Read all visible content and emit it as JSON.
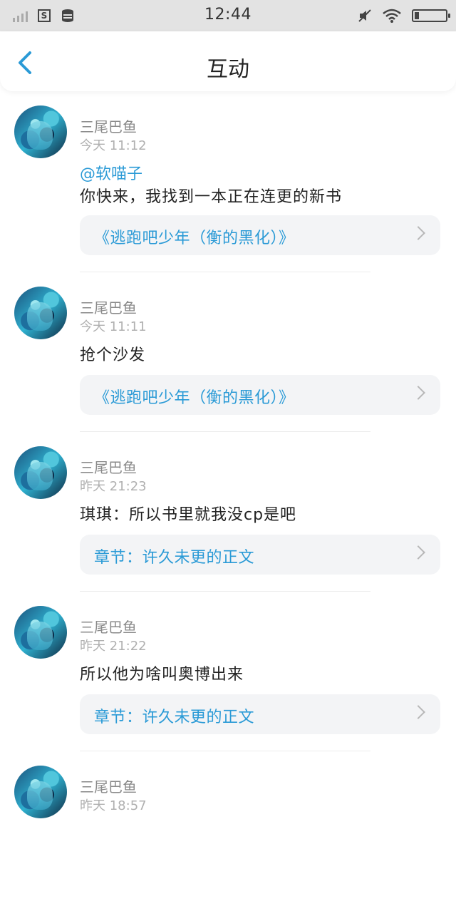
{
  "status_bar": {
    "time": "12:44"
  },
  "header": {
    "title": "互动"
  },
  "feed": [
    {
      "username": "三尾巴鱼",
      "time": "今天 11:12",
      "mention": "@软喵子",
      "text": "你快来，我找到一本正在连更的新书",
      "link": "《逃跑吧少年（衡的黑化）》"
    },
    {
      "username": "三尾巴鱼",
      "time": "今天 11:11",
      "text": "抢个沙发",
      "link": "《逃跑吧少年（衡的黑化）》"
    },
    {
      "username": "三尾巴鱼",
      "time": "昨天 21:23",
      "text": "琪琪：所以书里就我没cp是吧",
      "link": "章节：许久未更的正文"
    },
    {
      "username": "三尾巴鱼",
      "time": "昨天 21:22",
      "text": "所以他为啥叫奥博出来",
      "link": "章节：许久未更的正文"
    },
    {
      "username": "三尾巴鱼",
      "time": "昨天 18:57"
    }
  ]
}
